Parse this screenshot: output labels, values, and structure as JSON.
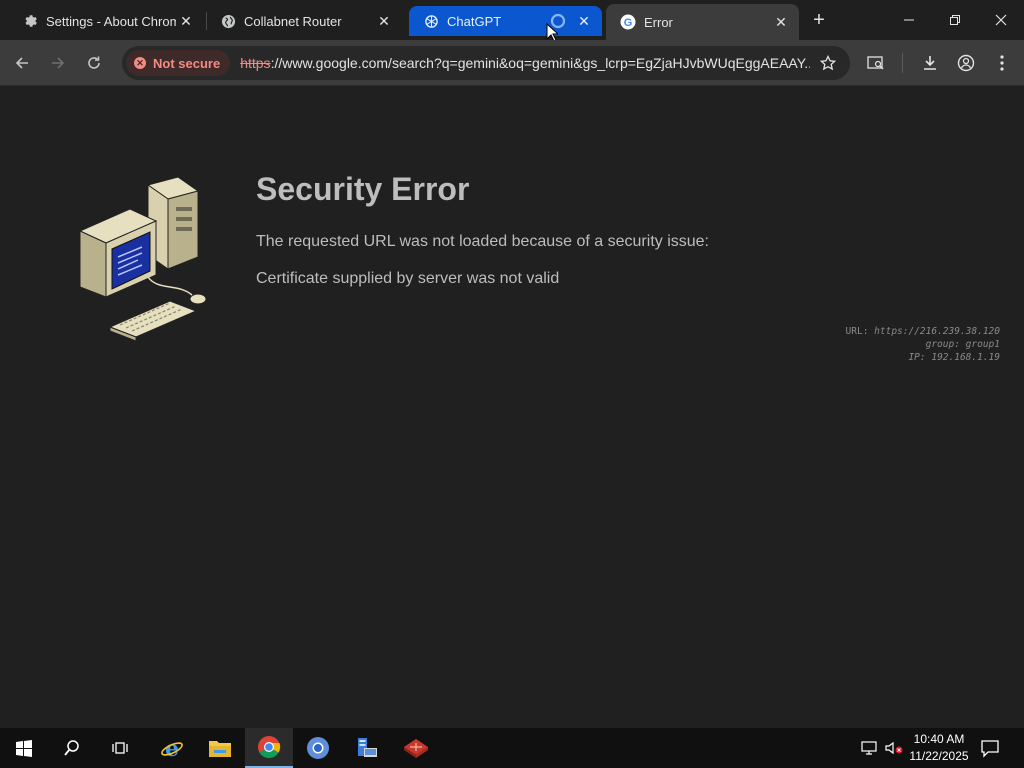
{
  "tabs": [
    {
      "title": "Settings - About Chrome",
      "icon": "gear-icon"
    },
    {
      "title": "Collabnet Router",
      "icon": "globe-icon"
    },
    {
      "title": "ChatGPT",
      "icon": "chatgpt-icon",
      "loading": true
    },
    {
      "title": "Error",
      "icon": "google-icon"
    }
  ],
  "toolbar": {
    "security_chip": "Not secure",
    "url_scheme": "https",
    "url_rest": "://www.google.com/search?q=gemini&oq=gemini&gs_lcrp=EgZjaHJvbWUqEggAEAAY..."
  },
  "page": {
    "title": "Security Error",
    "line1": "The requested URL was not loaded because of a security issue:",
    "line2": "Certificate supplied by server was not valid",
    "meta": {
      "url_label": "URL:",
      "url_value": "https://216.239.38.120",
      "group_label": "group:",
      "group_value": "group1",
      "ip_label": "IP:",
      "ip_value": "192.168.1.19"
    }
  },
  "taskbar": {
    "apps": [
      "start-icon",
      "search-icon",
      "task-view-icon",
      "internet-explorer-icon",
      "file-explorer-icon",
      "chrome-icon",
      "chromium-icon",
      "server-manager-icon",
      "network-app-icon"
    ],
    "time": "10:40 AM",
    "date": "11/22/2025"
  },
  "colors": {
    "accent_tab": "#0b57d0",
    "not_secure": "#f28b82",
    "page_bg": "#202020"
  }
}
